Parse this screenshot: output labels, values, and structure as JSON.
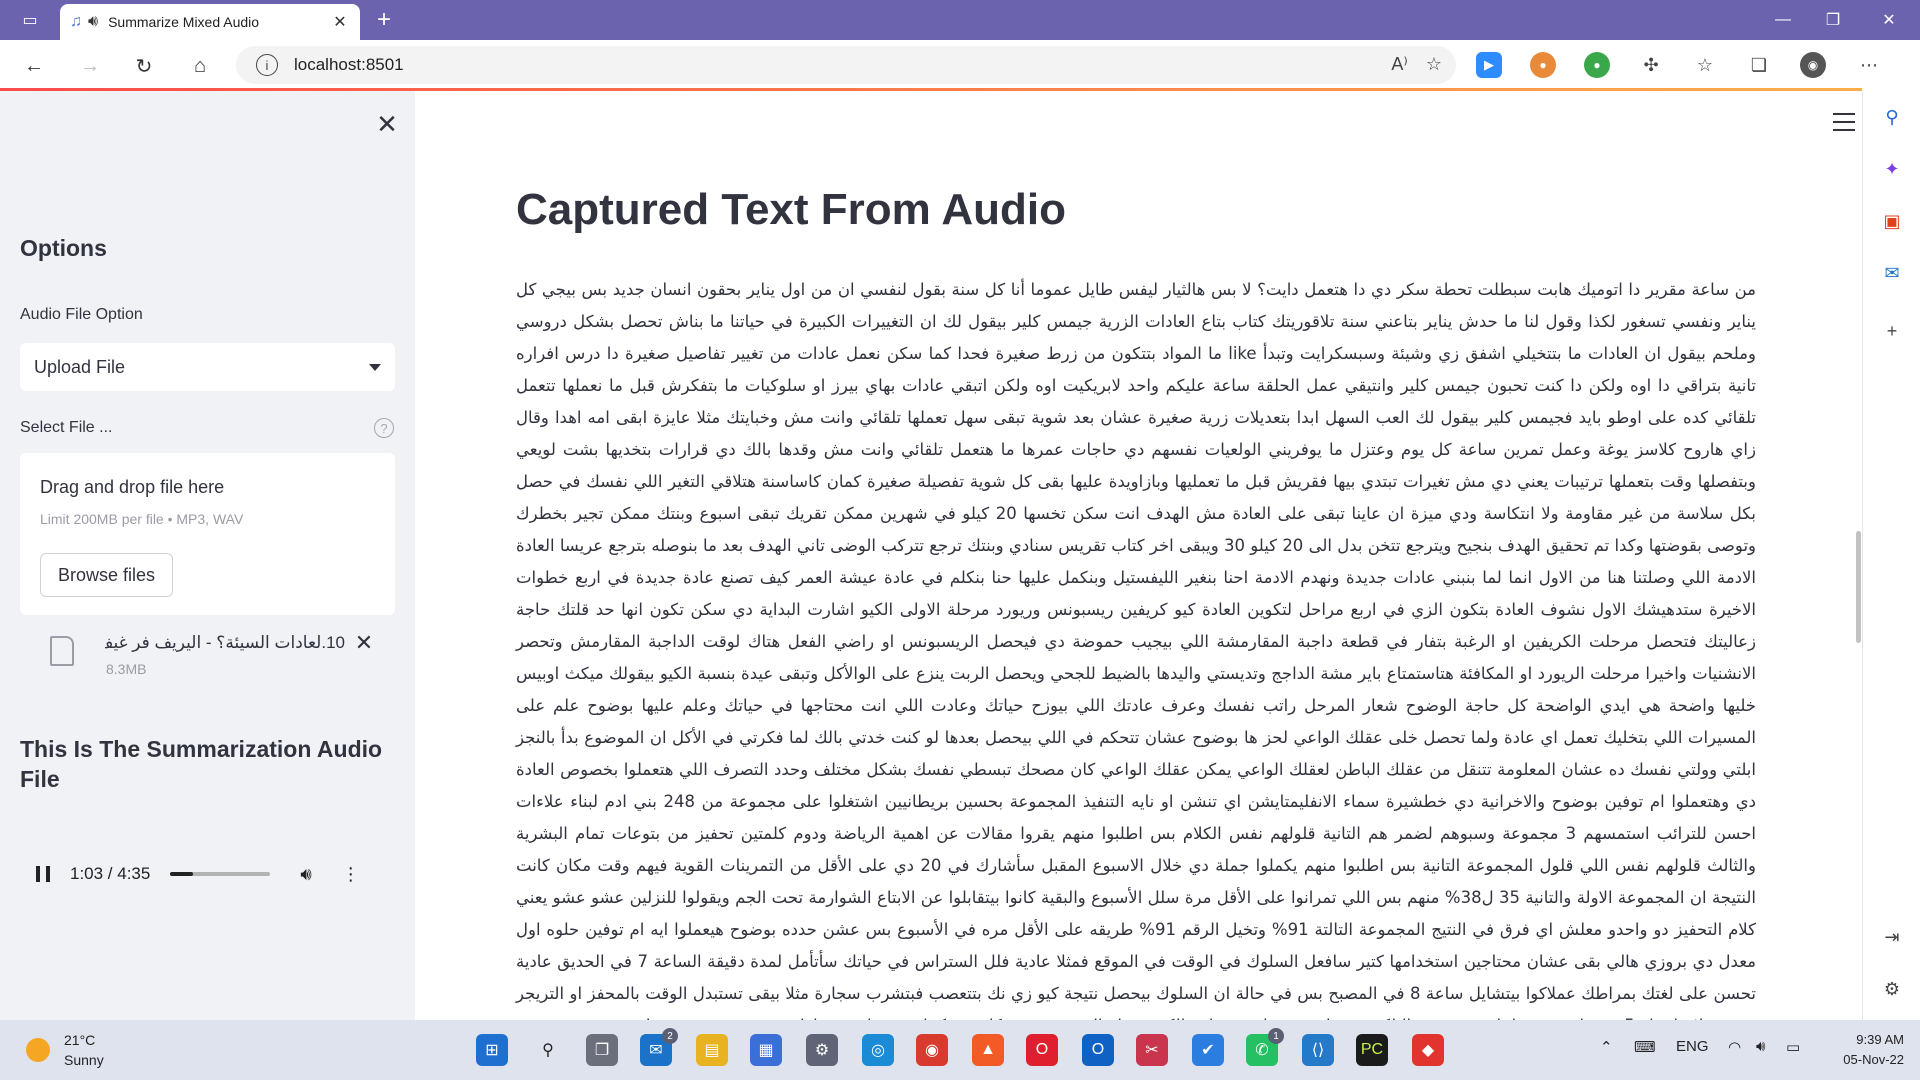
{
  "browser": {
    "tab_title": "Summarize Mixed Audio",
    "url": "localhost:8501"
  },
  "sidebar": {
    "heading": "Options",
    "audio_option_label": "Audio File Option",
    "audio_option_value": "Upload File",
    "select_file_label": "Select File ...",
    "dropzone_title": "Drag and drop file here",
    "dropzone_limits": "Limit 200MB per file • MP3, WAV",
    "browse_label": "Browse files",
    "file_name": "10.لعادات السيئة؟ - اليريف فر غيف...",
    "file_size": "8.3MB",
    "summary_heading": "This Is The Summarization Audio File",
    "player": {
      "time": "1:03 / 4:35",
      "progress": 0.23
    }
  },
  "main": {
    "title": "Captured Text From Audio",
    "transcript": "من ساعة مقرير دا اتوميك هابت سبطلت تحطة سكر دي دا هتعمل دايت؟ لا بس هالثيار ليفس طايل عموما أنا كل سنة بقول لنفسي ان من اول يناير بحقون انسان جديد بس بيجي كل يناير ونفسي تسغور لكذا وقول لنا ما حدش يناير بتاعني سنة تلاقوريتك كتاب بتاع العادات الزرية جيمس كلير بيقول لك ان التغييرات الكبيرة في حياتنا ما بناش تحصل بشكل دروسي وملحم بيقول ان العادات ما بتتخيلي اشفق زي وشيئة وسبسكرايت وتبدأ like ما المواد بتتكون من زرط صغيرة فحدا كما سكن نعمل عادات من تغيير تفاصيل صغيرة دا درس افراره تانية بتراقي دا اوه ولكن دا كنت تحبون جيمس كلير وانتيقي عمل الحلقة ساعة عليكم واحد لابريكيت اوه ولكن اتبقي عادات بهاي بيرز او سلوكيات ما بتفكرش قبل ما نعملها تتعمل تلقائي كده على اوطو بايد فجيمس كلير بيقول لك العب السهل ابدا بتعديلات زرية صغيرة عشان بعد شوية تبقى سهل تعملها تلقائي وانت مش وخبايتك مثلا عايزة ابقى امه اهدا وقال زاي هاروح كلاسز يوغة وعمل تمرين ساعة كل يوم وعتزل ما يوفريني الولعيات نفسهم دي حاجات عمرها ما هتعمل تلقائي وانت مش وقدها بالك دي قرارات بتخديها بشت لويعي وبتفصلها وقت بتعملها ترتيبات يعني دي مش تغيرات تبتدي بيها فقريش قبل ما تعمليها وبازاويدة عليها بقى كل شوية تفصيلة صغيرة كمان كاساسنة هتلاقي التغير اللي نفسك في حصل بكل سلاسة من غير مقاومة ولا انتكاسة ودي ميزة ان عاينا تبقى على العادة مش الهدف انت سكن تخسها 20 كيلو في شهرين ممكن تقريك تبقى اسبوع وبنتك ممكن تجير بخطرك وتوصى بقوضتها وكدا تم تحقيق الهدف بنجيح ويترجع تتخن بدل الى 20 كيلو 30 ويبقى اخر كتاب تقريس سنادي وبنتك ترجع تتركب الوضى تاني الهدف بعد ما بنوصله بترجع عريسا العادة الادمة اللي وصلتنا هنا من الاول انما لما بنبني عادات جديدة ونهدم الادمة احنا بنغير الليفستيل وبنكمل عليها حنا بنكلم في عادة عيشة العمر كيف تصنع عادة جديدة في اربع خطوات الاخيرة ستدهيشك الاول نشوف العادة بتكون الزي في اربع مراحل لتكوين العادة كيو كريفين ريسبونس وريورد مرحلة الاولى الكيو اشارت البداية دي سكن تكون انها حد قلتك حاجة زعاليتك فتحصل مرحلت الكريفين او الرغبة بتفار في قطعة داجبة المقارمشة اللي بيجيب حموضة دي فيحصل الريسبونس او راضي الفعل هتاك لوقت الداجبة المقارمش وتحصر الانشنيات واخيرا مرحلت الريورد او المكافئة هتاستمتاع باير مشة الداجج وتديستي واليدها بالضيط للجحي ويحصل الربت ينزع على الوالأكل وتبقى عيدة بنسبة الكيو بيقولك ميكث اوبيس خليها واضحة هي ايدي الواضحة كل حاجة الوضوح شعار المرحل راتب نفسك وعرف عادتك اللي بيوزح حياتك وعادت اللي انت محتاجها في حياتك وعلم عليها بوضوح علم على المسيرات اللي بتخليك تعمل اي عادة ولما تحصل خلى عقلك الواعي لحز ها بوضوح عشان تتحكم في اللي بيحصل بعدها لو كنت خدتي بالك لما فكرتي في الأكل ان الموضوع بدأ بالنجز ابلتي وولتي نفسك ده عشان المعلومة تتنقل من عقلك الباطن لعقلك الواعي يمكن عقلك الواعي كان مصحك تبسطي نفسك بشكل مختلف وحدد التصرف اللي هتعملوا بخصوص العادة دي وهتعملوا ام توفين بوضوح والاخرانية دي خطشيرة سماء الانفليمتايشن اي تنشن او نايه التنفيذ المجموعة بحسين بريطانيين اشتغلوا على مجموعة من 248 بني ادم لبناء علاءات احسن للترائب استمسهم 3 مجموعة وسبوهم لضمر هم التانية قلولهم نفس الكلام بس اطلبوا منهم يقروا مقالات عن اهمية الرياضة ودوم كلمتين تحفيز من بتوعات تمام البشرية والثالث قلولهم نفس اللي قلول المجموعة التانية بس اطلبوا منهم يكملوا جملة دي خلال الاسبوع المقبل سأشارك في 20 دي على الأقل من التمرينات القوية فيهم وقت مكان كانت النتيجة ان المجموعة الاولة والتانية 35 ل38% منهم بس اللي تمرانوا على الأقل مرة سلل الأسبوع والبقية كانوا بيتقابلوا عن الابتاع الشوارمة تحت الجم ويقولوا للنزلين عشو عشو يعني كلام التحفيز دو واحدو معلش اي فرق في النتيج المجموعة التالتة 91% وتخيل الرقم 91% طريقه على الأقل مره في الأسبوع بس عشن حدده بوضوح هيعملوا ايه ام توفين حلوه اول معدل دي بروزي هالي بقى عشان محتاجين استخدامها كتير سافعل السلوك في الوقت في الموقع فمثلا عادية فلل الستراس في حياتك سأتأمل لمدة دقيقة الساعة 7 في الحديق عادية تحسن على لغتك بمراطك عملاكوا بيتشايل ساعة 8 في المصبح بس في حالة ان السلوك بيحصل نتيجة كيو زي نك بتتعصب فبتشرب سجارة مثلا بيقى تستبدل الوقت بالمحفز او التريجر يعني مثلا هاعمل 5 تمرينات نفس لما تعصب في البلكون ندخل بقى على مرحلت الكريفنج او الرغبة جيمس كلير بيحكينا عن دراسة عملها بحسين من جمعت هاربرد في مستشفى مستشفى سلعين وقالوا عايزين نجرب نخل الناس يغيروا عدتهم من غير من قلو هم يغيروا عدتهم الكافتارية فيها تلاجات ميا وتلاجات صودة ام مزاودين ميا فتلاجات الصودة بس كده ولاعوا الناس بيتشرب ميا 25% اكتر من الاول وصودة 11% اقل من الاول فبساطة ومن غرفة زلكة اللي عايز"
  },
  "taskbar": {
    "temperature": "21°C",
    "condition": "Sunny",
    "language": "ENG",
    "time": "9:39 AM",
    "date": "05-Nov-22",
    "mail_badge": "2",
    "whatsapp_badge": "1"
  },
  "colors": {
    "titlebar": "#6b63ad",
    "sidebar_bg": "#f0f2f6",
    "text": "#31333f",
    "accent": "#ff4b4b"
  }
}
